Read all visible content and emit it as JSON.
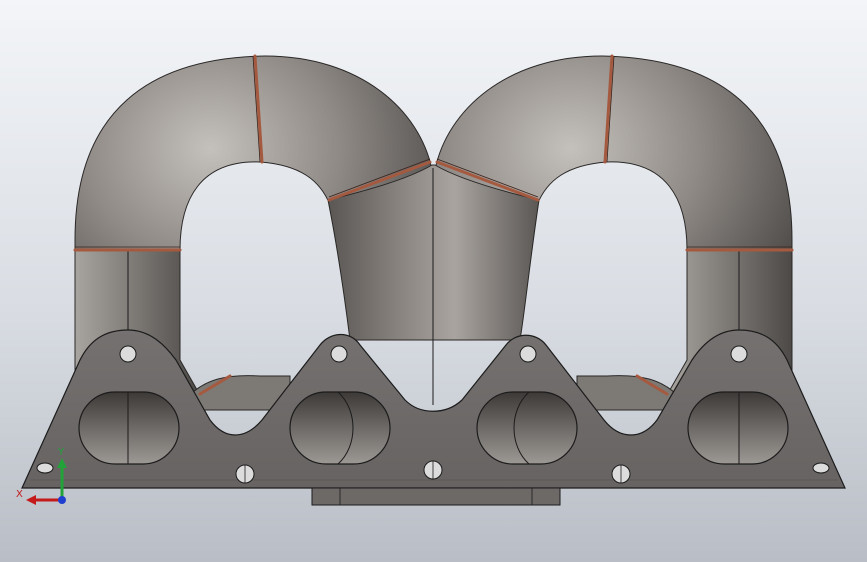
{
  "triad": {
    "x_label": "X",
    "y_label": "Y",
    "x_color": "#c41a1a",
    "y_color": "#21a33a",
    "z_color": "#1e3fd0"
  },
  "model": {
    "body_color": "#78736f",
    "flange_color": "#6f6b68",
    "weld_color": "#b0654a",
    "edge_color": "#1c1c1c"
  }
}
